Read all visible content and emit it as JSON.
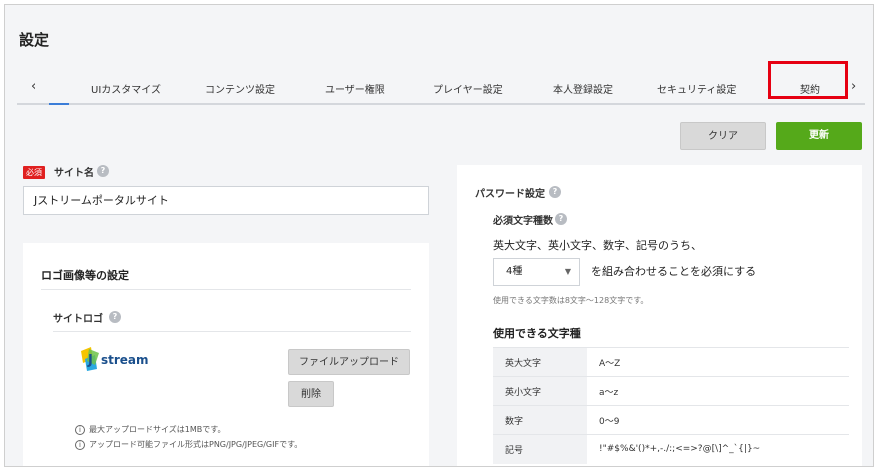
{
  "page": {
    "title": "設定"
  },
  "tabs": {
    "prev_icon": "chevron-left-icon",
    "next_icon": "chevron-right-icon",
    "items": [
      {
        "label": "UIカスタマイズ"
      },
      {
        "label": "コンテンツ設定"
      },
      {
        "label": "ユーザー権限"
      },
      {
        "label": "プレイヤー設定"
      },
      {
        "label": "本人登録設定"
      },
      {
        "label": "セキュリティ設定"
      },
      {
        "label": "契約"
      }
    ],
    "highlight_color": "#e60012"
  },
  "actions": {
    "clear_label": "クリア",
    "update_label": "更新",
    "update_color": "#55a91a"
  },
  "site_name": {
    "required_badge": "必須",
    "label": "サイト名",
    "value": "Jストリームポータルサイト"
  },
  "logo_settings": {
    "title": "ロゴ画像等の設定",
    "site_logo_label": "サイトロゴ",
    "logo_text": "stream",
    "logo_initial": "J",
    "upload_label": "ファイルアップロード",
    "delete_label": "削除",
    "notes": [
      "最大アップロードサイズは1MBです。",
      "アップロード可能ファイル形式はPNG/JPG/JPEG/GIFです。"
    ]
  },
  "password": {
    "title": "パスワード設定",
    "required_count_label": "必須文字種数",
    "sentence1": "英大文字、英小文字、数字、記号のうち、",
    "select_value": "4種",
    "sentence2": "を組み合わせることを必須にする",
    "hint": "使用できる文字数は8文字〜128文字です。",
    "chars_title": "使用できる文字種",
    "char_types": [
      {
        "name": "英大文字",
        "value": "A〜Z"
      },
      {
        "name": "英小文字",
        "value": "a〜z"
      },
      {
        "name": "数字",
        "value": "0〜9"
      },
      {
        "name": "記号",
        "value": "!\"#$%&'()*+,-./:;<=>?@[\\]^_`{|}~"
      }
    ]
  }
}
